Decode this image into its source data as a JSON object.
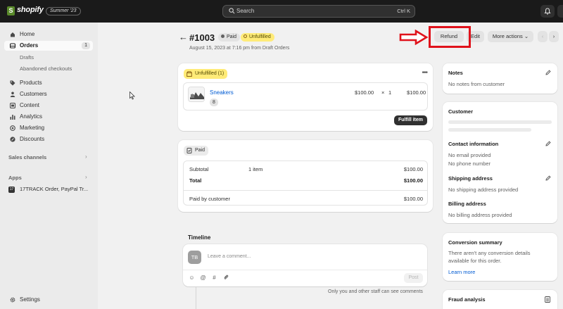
{
  "topbar": {
    "brand": "shopify",
    "edition": "Summer '23",
    "search_placeholder": "Search",
    "search_shortcut": "Ctrl K"
  },
  "sidebar": {
    "items": [
      {
        "label": "Home"
      },
      {
        "label": "Orders",
        "badge": "1"
      },
      {
        "label": "Products"
      },
      {
        "label": "Customers"
      },
      {
        "label": "Content"
      },
      {
        "label": "Analytics"
      },
      {
        "label": "Marketing"
      },
      {
        "label": "Discounts"
      }
    ],
    "orders_sub": [
      "Drafts",
      "Abandoned checkouts"
    ],
    "sales_channels": "Sales channels",
    "apps": "Apps",
    "app_item": {
      "icon": "17",
      "label": "17TRACK Order, PayPal Tr..."
    },
    "settings": "Settings"
  },
  "header": {
    "title": "#1003",
    "paid_badge": "Paid",
    "unfulfilled_badge": "Unfulfilled",
    "subtitle": "August 15, 2023 at 7:16 pm from Draft Orders",
    "actions": {
      "refund": "Refund",
      "edit": "Edit",
      "more": "More actions"
    }
  },
  "fulfillment": {
    "status": "Unfulfilled (1)",
    "product": {
      "name": "Sneakers",
      "qty_badge": "8",
      "unit_price": "$100.00",
      "times": "×",
      "quantity": "1",
      "total": "$100.00"
    },
    "fulfill_button": "Fulfill item"
  },
  "payment": {
    "status": "Paid",
    "subtotal_label": "Subtotal",
    "subtotal_items": "1 item",
    "subtotal_value": "$100.00",
    "total_label": "Total",
    "total_value": "$100.00",
    "paid_label": "Paid by customer",
    "paid_value": "$100.00"
  },
  "timeline": {
    "title": "Timeline",
    "avatar": "TB",
    "placeholder": "Leave a comment...",
    "post": "Post",
    "note": "Only you and other staff can see comments"
  },
  "notes": {
    "title": "Notes",
    "text": "No notes from customer"
  },
  "customer": {
    "title": "Customer",
    "contact_title": "Contact information",
    "no_email": "No email provided",
    "no_phone": "No phone number",
    "shipping_title": "Shipping address",
    "shipping_text": "No shipping address provided",
    "billing_title": "Billing address",
    "billing_text": "No billing address provided"
  },
  "conversion": {
    "title": "Conversion summary",
    "text_line1": "There aren't any conversion details",
    "text_line2": "available for this order.",
    "link": "Learn more"
  },
  "fraud": {
    "title": "Fraud analysis"
  },
  "colors": {
    "topbar": "#1a1a1a",
    "annotation_red": "#e0121b",
    "unfulfilled_yellow": "#ffeb78",
    "link_blue": "#005bd3"
  }
}
